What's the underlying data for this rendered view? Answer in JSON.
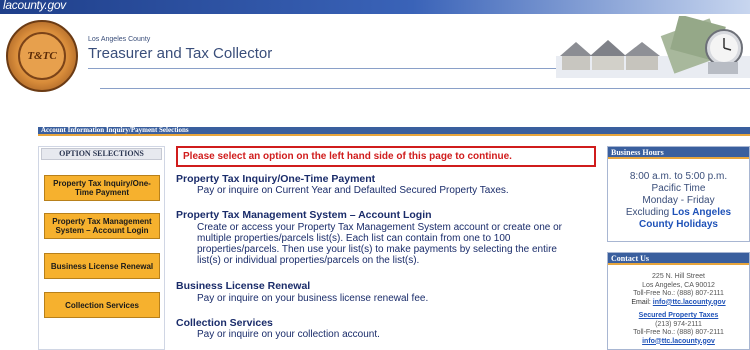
{
  "topbar": {
    "logo": "lacounty.gov"
  },
  "header": {
    "seal_text": "T&TC",
    "agency_sub": "Los Angeles County",
    "agency_title": "Treasurer and Tax Collector"
  },
  "section_bar": {
    "title": "Account Information Inquiry/Payment Selections"
  },
  "options": {
    "header": "OPTION SELECTIONS",
    "items": [
      {
        "label": "Property Tax Inquiry/One-Time Payment"
      },
      {
        "label": "Property Tax Management System – Account Login"
      },
      {
        "label": "Business License Renewal"
      },
      {
        "label": "Collection Services"
      }
    ]
  },
  "main": {
    "alert": "Please select an option on the left hand side of this page to continue.",
    "items": [
      {
        "title": "Property Tax Inquiry/One-Time Payment",
        "desc": "Pay or inquire on Current Year and Defaulted Secured Property Taxes."
      },
      {
        "title": "Property Tax Management System – Account Login",
        "desc": "Create or access your Property Tax Management System account or create one or multiple properties/parcels list(s). Each list can contain from one to 100 properties/parcels. Then use your list(s) to make payments by selecting the entire list(s) or individual properties/parcels on the list(s)."
      },
      {
        "title": "Business License Renewal",
        "desc": "Pay or inquire on your business license renewal fee."
      },
      {
        "title": "Collection Services",
        "desc": "Pay or inquire on your collection account."
      }
    ]
  },
  "hours": {
    "header": "Business Hours",
    "line1": "8:00 a.m. to 5:00 p.m.",
    "line2": "Pacific Time",
    "line3": "Monday - Friday",
    "line4_prefix": "Excluding ",
    "line4_link": "Los Angeles",
    "line5_link": "County Holidays"
  },
  "contact": {
    "header": "Contact Us",
    "addr1": "225 N. Hill Street",
    "addr2": "Los Angeles, CA 90012",
    "tollfree1": "Toll-Free No.: (888) 807-2111",
    "email_label": "Email: ",
    "email": "info@ttc.lacounty.gov",
    "secured_title": "Secured Property Taxes",
    "secured_phone": "(213) 974-2111",
    "tollfree2": "Toll-Free No.: (888) 807-2111",
    "email2": "info@ttc.lacounty.gov"
  }
}
